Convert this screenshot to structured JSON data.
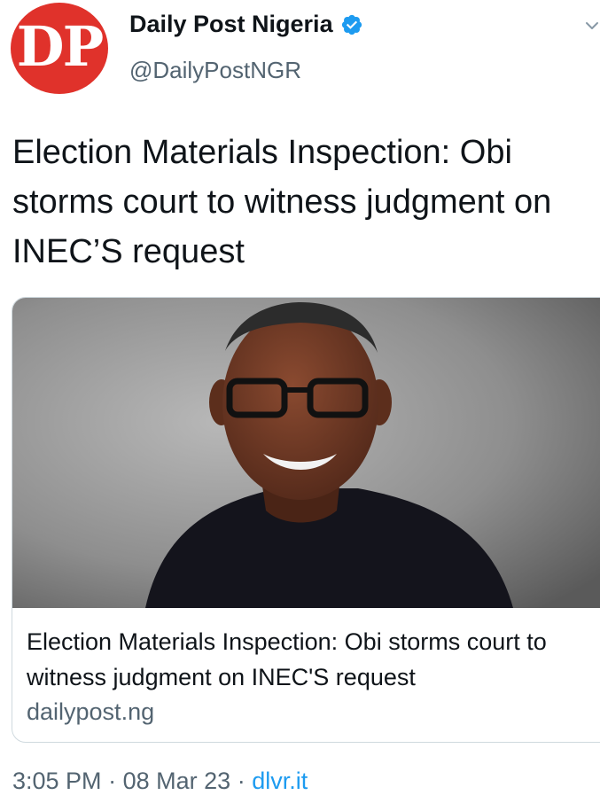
{
  "author": {
    "avatar_text": "DP",
    "name": "Daily Post Nigeria",
    "handle": "@DailyPostNGR",
    "verified_icon": "verified-badge-icon",
    "brand_color": "#e0322b",
    "verified_color": "#1d9bf0"
  },
  "tweet": {
    "text": "Election Materials Inspection: Obi storms court to witness judgment on INEC’S request"
  },
  "card": {
    "image_icon": "news-photo",
    "title": "Election Materials Inspection: Obi storms court to witness judgment on INEC'S request",
    "domain": "dailypost.ng"
  },
  "meta": {
    "time": "3:05 PM",
    "separator": "·",
    "date": "08 Mar 23",
    "source": "dlvr.it"
  },
  "menu": {
    "icon": "chevron-down-icon"
  }
}
